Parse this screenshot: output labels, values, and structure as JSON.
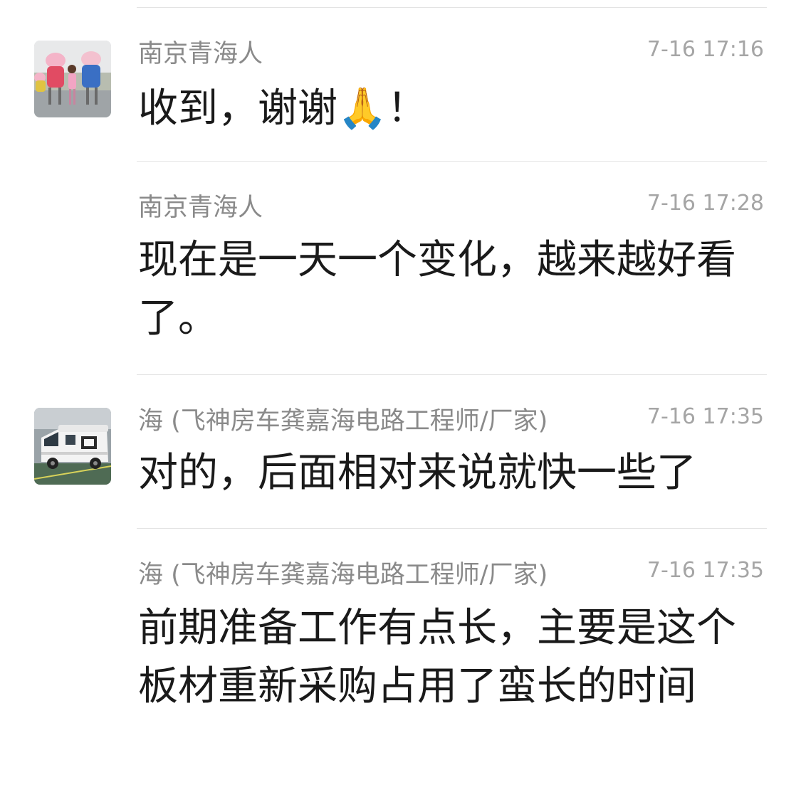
{
  "messages": [
    {
      "sender": "南京青海人",
      "time": "7-16 17:16",
      "text": "收到，谢谢🙏！",
      "avatar_icon": "peppa-pig-photo-avatar"
    },
    {
      "sender": "南京青海人",
      "time": "7-16 17:28",
      "text": "现在是一天一个变化，越来越好看了。"
    },
    {
      "sender": "海 (飞神房车龚嘉海电路工程师/厂家)",
      "time": "7-16 17:35",
      "text": "对的，后面相对来说就快一些了",
      "avatar_icon": "rv-van-photo-avatar"
    },
    {
      "sender": "海 (飞神房车龚嘉海电路工程师/厂家)",
      "time": "7-16 17:35",
      "text": "前期准备工作有点长，主要是这个板材重新采购占用了蛮长的时间"
    }
  ]
}
